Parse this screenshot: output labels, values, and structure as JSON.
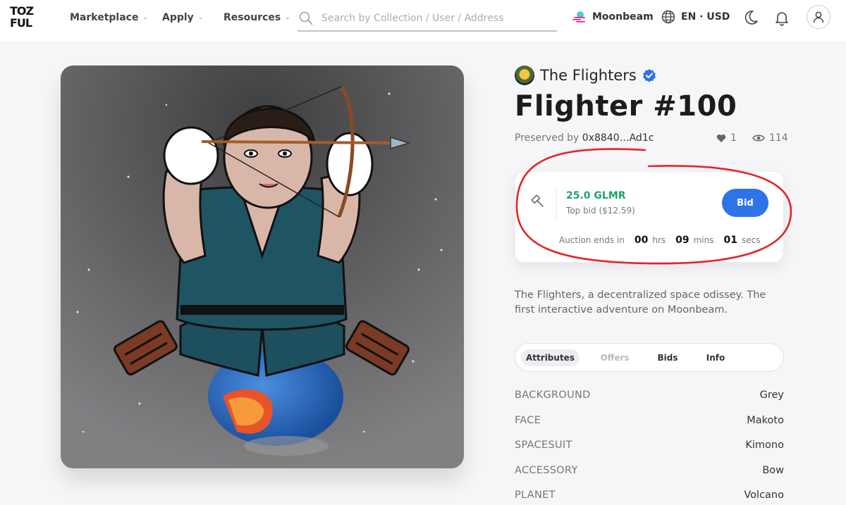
{
  "header": {
    "logo": {
      "line1": "TOZ",
      "line2": "FUL"
    },
    "nav": [
      {
        "label": "Marketplace"
      },
      {
        "label": "Apply"
      },
      {
        "label": "Resources"
      }
    ],
    "search": {
      "placeholder": "Search by Collection / User / Address",
      "value": ""
    },
    "chain": {
      "label": "Moonbeam"
    },
    "locale": {
      "label": "EN · USD"
    },
    "icons": [
      "moon-icon",
      "bell-icon",
      "user-icon"
    ]
  },
  "nft": {
    "collection": "The Flighters",
    "verified": true,
    "title": "Flighter #100",
    "preserved_prefix": "Preserved by",
    "owner_address": "0x8840…Ad1c",
    "likes": "1",
    "views": "114",
    "description": "The Flighters, a decentralized space odissey. The first interactive adventure on Moonbeam."
  },
  "auction": {
    "price": "25.0 GLMR",
    "top_bid_label": "Top bid ($12.59)",
    "bid_button": "Bid",
    "ends_label": "Auction ends in",
    "hours": "00",
    "hours_unit": "hrs",
    "minutes": "09",
    "minutes_unit": "mins",
    "seconds": "01",
    "seconds_unit": "secs"
  },
  "tabs": [
    {
      "label": "Attributes",
      "state": "active"
    },
    {
      "label": "Offers",
      "state": "disabled"
    },
    {
      "label": "Bids",
      "state": "normal"
    },
    {
      "label": "Info",
      "state": "normal"
    }
  ],
  "attributes": [
    {
      "key": "BACKGROUND",
      "value": "Grey"
    },
    {
      "key": "FACE",
      "value": "Makoto"
    },
    {
      "key": "SPACESUIT",
      "value": "Kimono"
    },
    {
      "key": "ACCESSORY",
      "value": "Bow"
    },
    {
      "key": "PLANET",
      "value": "Volcano"
    }
  ],
  "colors": {
    "accent": "#2f73e9",
    "price_green": "#1fa36b",
    "annotation_red": "#e0262a"
  }
}
